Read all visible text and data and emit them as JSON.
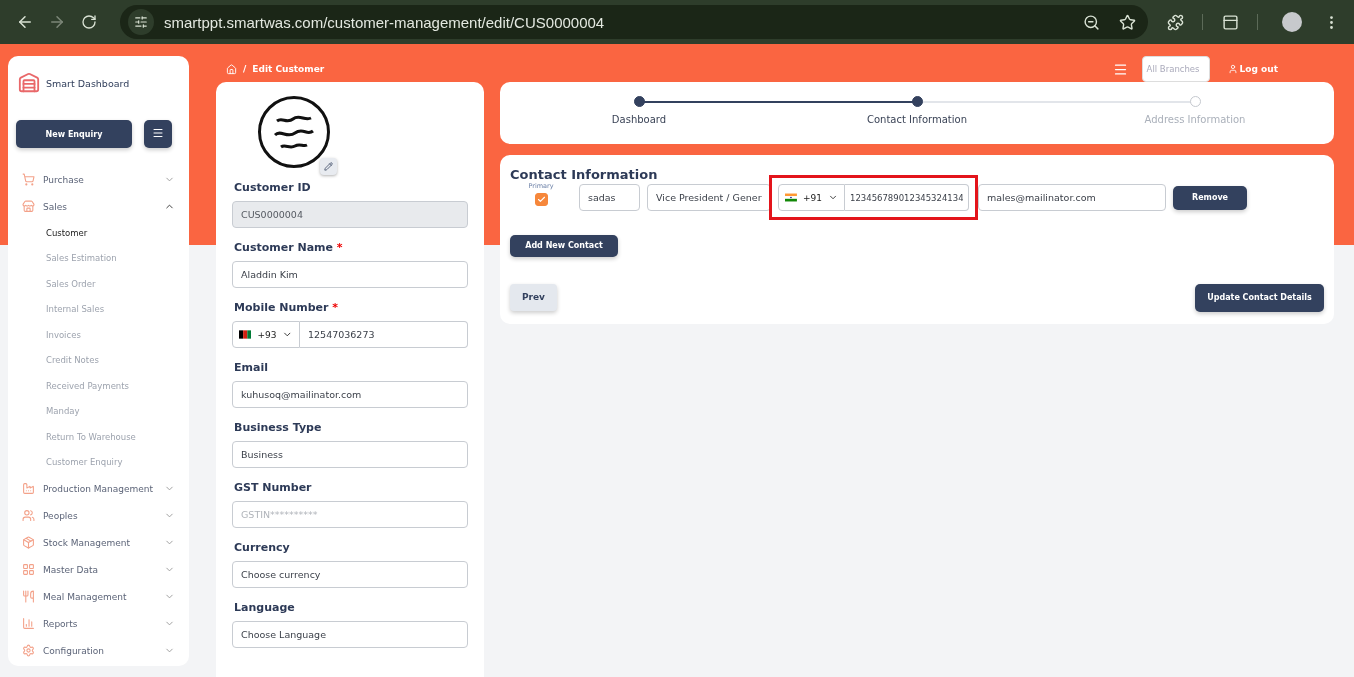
{
  "browser": {
    "url": "smartppt.smartwas.com/customer-management/edit/CUS0000004"
  },
  "sidebar": {
    "brand": "Smart Dashboard",
    "new_button": "New Enquiry",
    "items": [
      {
        "label": "Purchase",
        "expanded": false
      },
      {
        "label": "Sales",
        "expanded": true,
        "children": [
          {
            "label": "Customer",
            "selected": true
          },
          {
            "label": "Sales Estimation",
            "selected": false
          },
          {
            "label": "Sales Order",
            "selected": false
          },
          {
            "label": "Internal Sales",
            "selected": false
          },
          {
            "label": "Invoices",
            "selected": false
          },
          {
            "label": "Credit Notes",
            "selected": false
          },
          {
            "label": "Received Payments",
            "selected": false
          },
          {
            "label": "Manday",
            "selected": false
          },
          {
            "label": "Return To Warehouse",
            "selected": false
          },
          {
            "label": "Customer Enquiry",
            "selected": false
          }
        ]
      },
      {
        "label": "Production Management",
        "expanded": false
      },
      {
        "label": "Peoples",
        "expanded": false
      },
      {
        "label": "Stock Management",
        "expanded": false
      },
      {
        "label": "Master Data",
        "expanded": false
      },
      {
        "label": "Meal Management",
        "expanded": false
      },
      {
        "label": "Reports",
        "expanded": false
      },
      {
        "label": "Configuration",
        "expanded": false
      }
    ]
  },
  "topbar": {
    "separator": "/",
    "breadcrumb": "Edit Customer",
    "branch_select": "All Branches",
    "logout": "Log out"
  },
  "customer_form": {
    "fields": [
      {
        "kind": "text",
        "label": "Customer ID",
        "disabled": true,
        "value": "CUS0000004"
      },
      {
        "kind": "text",
        "label": "Customer Name",
        "required_mark": "*",
        "value": "Aladdin Kim"
      },
      {
        "kind": "phone",
        "label": "Mobile Number",
        "required_mark": "*",
        "code": "+93",
        "value": "12547036273"
      },
      {
        "kind": "text",
        "label": "Email",
        "value": "kuhusoq@mailinator.com"
      },
      {
        "kind": "text",
        "label": "Business Type",
        "value": "Business"
      },
      {
        "kind": "text",
        "label": "GST Number",
        "placeholder": "GSTIN**********"
      },
      {
        "kind": "text",
        "label": "Currency",
        "value": "Choose currency"
      },
      {
        "kind": "text",
        "label": "Language",
        "value": "Choose Language"
      }
    ]
  },
  "stepper": [
    {
      "label": "Dashboard",
      "reached": true
    },
    {
      "label": "Contact Information",
      "reached": true
    },
    {
      "label": "Address Information",
      "reached": false
    }
  ],
  "contact_section": {
    "title": "Contact Information",
    "primary_label": "Primary",
    "contacts": [
      {
        "primary": true,
        "name": "sadas",
        "designation": "Vice President / Gener",
        "code": "+91",
        "phone": "123456789012345324134",
        "phone_highlighted": true,
        "email": "males@mailinator.com",
        "remove": "Remove"
      }
    ],
    "add_button": "Add New Contact",
    "prev_button": "Prev",
    "update_button": "Update Contact Details"
  }
}
